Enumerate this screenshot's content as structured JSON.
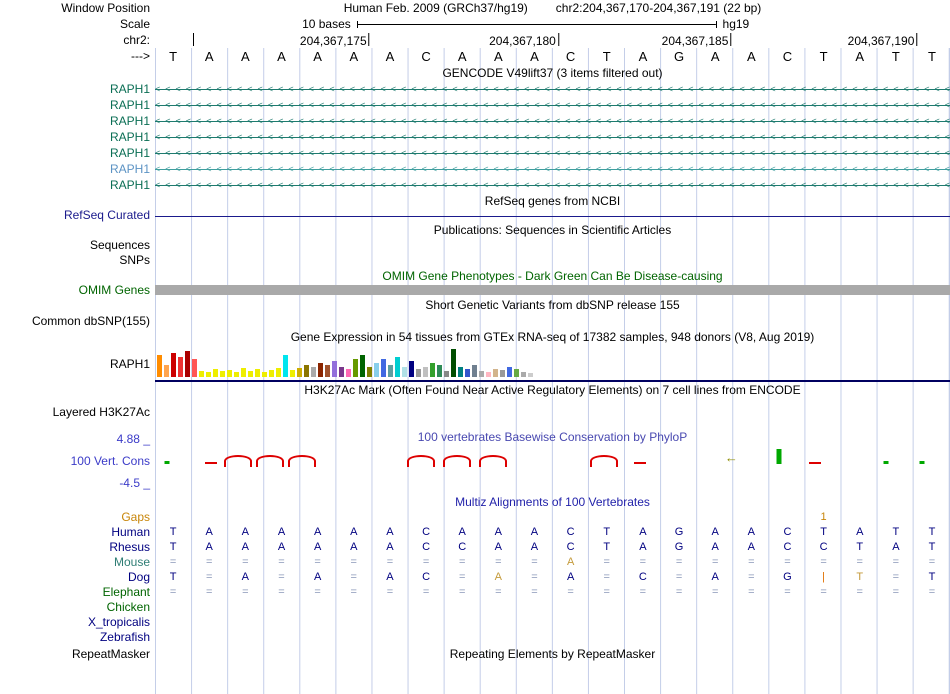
{
  "title": {
    "assembly": "Human Feb. 2009 (GRCh37/hg19)",
    "position": "chr2:204,367,170-204,367,191 (22 bp)"
  },
  "left_labels": {
    "window_position": "Window Position",
    "scale": "Scale",
    "chrom": "chr2:",
    "strand": "--->"
  },
  "scale_bar": {
    "label": "10 bases",
    "assembly": "hg19"
  },
  "ruler": {
    "lead_tick_x": 4.8,
    "ticks": [
      {
        "label": "204,367,175",
        "x": 27
      },
      {
        "label": "204,367,180",
        "x": 50.8
      },
      {
        "label": "204,367,185",
        "x": 72.5
      },
      {
        "label": "204,367,190",
        "x": 95.9
      }
    ]
  },
  "sequence": {
    "bases": [
      "T",
      "A",
      "A",
      "A",
      "A",
      "A",
      "A",
      "C",
      "A",
      "A",
      "A",
      "C",
      "T",
      "A",
      "G",
      "A",
      "A",
      "C",
      "T",
      "A",
      "T",
      "T"
    ]
  },
  "gencode": {
    "header": "GENCODE V49lift37 (3 items filtered out)",
    "gene": "RAPH1",
    "row_count": 7,
    "light_row": 5
  },
  "refseq": {
    "header": "RefSeq genes from NCBI",
    "label": "RefSeq Curated"
  },
  "publications": {
    "header": "Publications: Sequences in Scientific Articles",
    "labels": [
      "Sequences",
      "SNPs"
    ]
  },
  "omim": {
    "header": "OMIM Gene Phenotypes - Dark Green Can Be Disease-causing",
    "label": "OMIM Genes"
  },
  "dbsnp": {
    "header": "Short Genetic Variants from dbSNP release 155",
    "label": "Common dbSNP(155)"
  },
  "gtex": {
    "header": "Gene Expression in 54 tissues from GTEx RNA-seq of 17382 samples, 948 donors (V8, Aug 2019)",
    "label": "RAPH1",
    "bars": [
      {
        "h": 22,
        "c": "#ff8c00"
      },
      {
        "h": 12,
        "c": "#ffa54f"
      },
      {
        "h": 24,
        "c": "#cc0000"
      },
      {
        "h": 20,
        "c": "#ee3333"
      },
      {
        "h": 26,
        "c": "#aa0000"
      },
      {
        "h": 18,
        "c": "#ff5555"
      },
      {
        "h": 6,
        "c": "#eeee00"
      },
      {
        "h": 5,
        "c": "#eeee00"
      },
      {
        "h": 8,
        "c": "#eeee00"
      },
      {
        "h": 6,
        "c": "#eeee00"
      },
      {
        "h": 7,
        "c": "#eeee00"
      },
      {
        "h": 5,
        "c": "#eeee00"
      },
      {
        "h": 9,
        "c": "#eeee00"
      },
      {
        "h": 6,
        "c": "#eeee00"
      },
      {
        "h": 8,
        "c": "#eeee00"
      },
      {
        "h": 5,
        "c": "#eeee00"
      },
      {
        "h": 7,
        "c": "#eeee00"
      },
      {
        "h": 9,
        "c": "#eeee00"
      },
      {
        "h": 22,
        "c": "#00e5ee"
      },
      {
        "h": 7,
        "c": "#eeee00"
      },
      {
        "h": 9,
        "c": "#cdad00"
      },
      {
        "h": 12,
        "c": "#8b7500"
      },
      {
        "h": 10,
        "c": "#aaaaaa"
      },
      {
        "h": 14,
        "c": "#8b2500"
      },
      {
        "h": 12,
        "c": "#a0522d"
      },
      {
        "h": 16,
        "c": "#9370db"
      },
      {
        "h": 10,
        "c": "#7a378b"
      },
      {
        "h": 8,
        "c": "#ff69b4"
      },
      {
        "h": 18,
        "c": "#669900"
      },
      {
        "h": 22,
        "c": "#006400"
      },
      {
        "h": 10,
        "c": "#808000"
      },
      {
        "h": 14,
        "c": "#87ceeb"
      },
      {
        "h": 18,
        "c": "#4169e1"
      },
      {
        "h": 12,
        "c": "#5f9ea0"
      },
      {
        "h": 20,
        "c": "#00ced1"
      },
      {
        "h": 10,
        "c": "#b0e0e6"
      },
      {
        "h": 16,
        "c": "#000080"
      },
      {
        "h": 8,
        "c": "#999999"
      },
      {
        "h": 10,
        "c": "#c0c0c0"
      },
      {
        "h": 14,
        "c": "#33a02c"
      },
      {
        "h": 12,
        "c": "#2e8b57"
      },
      {
        "h": 6,
        "c": "#888888"
      },
      {
        "h": 28,
        "c": "#004d00"
      },
      {
        "h": 10,
        "c": "#008080"
      },
      {
        "h": 8,
        "c": "#3355cc"
      },
      {
        "h": 12,
        "c": "#708090"
      },
      {
        "h": 6,
        "c": "#aaaaaa"
      },
      {
        "h": 5,
        "c": "#ffb6c1"
      },
      {
        "h": 8,
        "c": "#d2b48c"
      },
      {
        "h": 7,
        "c": "#999999"
      },
      {
        "h": 10,
        "c": "#4169e1"
      },
      {
        "h": 8,
        "c": "#66aa44"
      },
      {
        "h": 5,
        "c": "#aaaaaa"
      },
      {
        "h": 4,
        "c": "#cccccc"
      }
    ]
  },
  "h3k27ac": {
    "header": "H3K27Ac Mark (Often Found Near Active Regulatory Elements) on 7 cell lines from ENCODE",
    "label": "Layered H3K27Ac"
  },
  "conservation": {
    "header": "100 vertebrates Basewise Conservation by PhyloP",
    "label": "100 Vert. Cons",
    "max_label": "4.88 _",
    "min_label": "-4.5 _",
    "marks": [
      {
        "type": "tick",
        "x": 1.5
      },
      {
        "type": "dash",
        "x": 7
      },
      {
        "type": "tent",
        "x": 10.5
      },
      {
        "type": "tent",
        "x": 14.5
      },
      {
        "type": "tent",
        "x": 18.5
      },
      {
        "type": "tent",
        "x": 33.5
      },
      {
        "type": "tent",
        "x": 38
      },
      {
        "type": "tent",
        "x": 42.5
      },
      {
        "type": "tent",
        "x": 56.5
      },
      {
        "type": "dash",
        "x": 61
      },
      {
        "type": "arrow",
        "x": 72.5
      },
      {
        "type": "bar",
        "x": 78.5
      },
      {
        "type": "dash",
        "x": 83
      },
      {
        "type": "tick",
        "x": 92
      },
      {
        "type": "tick",
        "x": 96.5
      }
    ]
  },
  "multiz": {
    "header": "Multiz Alignments of 100 Vertebrates",
    "species": [
      {
        "name": "Gaps",
        "label_color": "#c8860a",
        "cell_color": "#c8860a",
        "cells": [
          "",
          "",
          "",
          "",
          "",
          "",
          "",
          "",
          "",
          "",
          "",
          "",
          "",
          "",
          "",
          "",
          "",
          "",
          "1",
          "",
          "",
          ""
        ]
      },
      {
        "name": "Human",
        "label_color": "#000080",
        "cells": [
          "T",
          "A",
          "A",
          "A",
          "A",
          "A",
          "A",
          "C",
          "A",
          "A",
          "A",
          "C",
          "T",
          "A",
          "G",
          "A",
          "A",
          "C",
          "T",
          "A",
          "T",
          "T"
        ]
      },
      {
        "name": "Rhesus",
        "label_color": "#000080",
        "cells": [
          "T",
          "A",
          "A",
          "A",
          "A",
          "A",
          "A",
          "C",
          "C",
          "A",
          "A",
          "C",
          "T",
          "A",
          "G",
          "A",
          "A",
          "C",
          "C",
          "T",
          "A",
          "T"
        ]
      },
      {
        "name": "Mouse",
        "label_color": "#2e7d74",
        "cells": [
          "=",
          "=",
          "=",
          "=",
          "=",
          "=",
          "=",
          "=",
          "=",
          "=",
          "=",
          {
            "t": "A",
            "c": "#c49a3a"
          },
          "=",
          "=",
          "=",
          "=",
          "=",
          "=",
          "=",
          "=",
          "=",
          "="
        ]
      },
      {
        "name": "Dog",
        "label_color": "#000080",
        "cells": [
          "T",
          "=",
          "A",
          "=",
          "A",
          "=",
          "A",
          "C",
          "=",
          {
            "t": "A",
            "c": "#c49a3a"
          },
          "=",
          "A",
          "=",
          "C",
          "=",
          "A",
          "=",
          "G",
          {
            "t": "|",
            "c": "#e07000"
          },
          {
            "t": "T",
            "c": "#c49a3a"
          },
          "=",
          "T"
        ]
      },
      {
        "name": "Elephant",
        "label_color": "#006400",
        "cells": [
          "=",
          "=",
          "=",
          "=",
          "=",
          "=",
          "=",
          "=",
          "=",
          "=",
          "=",
          "=",
          "=",
          "=",
          "=",
          "=",
          "=",
          "=",
          "=",
          "=",
          "=",
          "="
        ]
      },
      {
        "name": "Chicken",
        "label_color": "#006400",
        "cells": [
          "",
          "",
          "",
          "",
          "",
          "",
          "",
          "",
          "",
          "",
          "",
          "",
          "",
          "",
          "",
          "",
          "",
          "",
          "",
          "",
          "",
          ""
        ]
      },
      {
        "name": "X_tropicalis",
        "label_color": "#000080",
        "cells": [
          "",
          "",
          "",
          "",
          "",
          "",
          "",
          "",
          "",
          "",
          "",
          "",
          "",
          "",
          "",
          "",
          "",
          "",
          "",
          "",
          "",
          ""
        ]
      },
      {
        "name": "Zebrafish",
        "label_color": "#000080",
        "cells": [
          "",
          "",
          "",
          "",
          "",
          "",
          "",
          "",
          "",
          "",
          "",
          "",
          "",
          "",
          "",
          "",
          "",
          "",
          "",
          "",
          "",
          ""
        ]
      }
    ]
  },
  "repeatmasker": {
    "header": "Repeating Elements by RepeatMasker",
    "label": "RepeatMasker"
  },
  "colors": {
    "guideline": "#c3cde8",
    "navy": "#000080",
    "eq": "#8a97b8",
    "gene_line": "#1d7a6e",
    "gene_line_light": "#3f9e9e",
    "gene_label": "#0a6e54",
    "gene_label_light": "#5c93c4",
    "omim_green": "#006400",
    "cons_blue": "#3b3bc8",
    "multiz_header_blue": "#2222aa"
  }
}
